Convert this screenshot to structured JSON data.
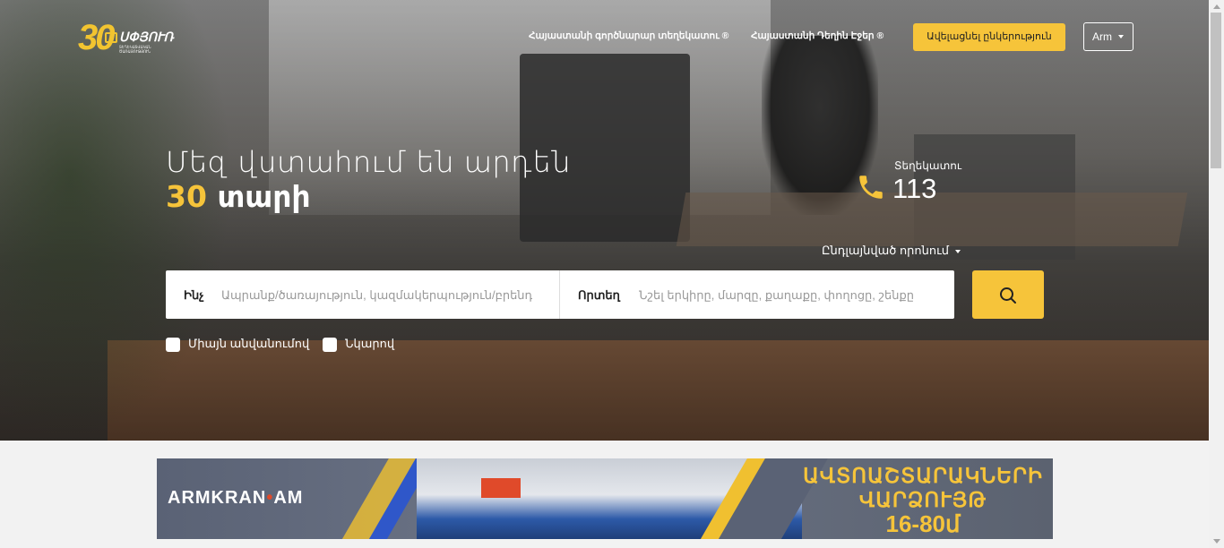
{
  "header": {
    "logo": {
      "number": "30",
      "name": "ՍՓՅՈՒՌ",
      "subtitle": "ՏԵՂԵԿԱՏՎԱԿԱՆ ԾԱՌԱՅՈՒԹՅՈՒՆ"
    },
    "nav": [
      {
        "label": "Հայաստանի գործնարար տեղեկատու ®"
      },
      {
        "label": "Հայաստանի Դեղին Էջեր ®"
      }
    ],
    "add_button": "Ավելացնել ընկերություն",
    "language": "Arm"
  },
  "hero": {
    "headline_line1": "Մեզ վստահում են արդեն",
    "headline_year": "30",
    "headline_word": "տարի",
    "phone_label": "Տեղեկատու",
    "phone_number": "113",
    "advanced_search": "Ընդլայնված որոնում"
  },
  "search": {
    "what_label": "Ինչ",
    "what_placeholder": "Ապրանք/ծառայություն, կազմակերպություն/բրենդ",
    "where_label": "Որտեղ",
    "where_placeholder": "Նշել երկիրը, մարզը, քաղաքը, փողոցը, շենքը",
    "checkbox_name_only": "Միայն անվանումով",
    "checkbox_with_photo": "Նկարով"
  },
  "banner": {
    "brand_left": "ARMKRAN",
    "brand_right": "AM",
    "line1": "ԱՎՏՈԱՇՏԱՐԱԿՆԵՐԻ",
    "line2": "ՎԱՐՁՈՒՅԹ",
    "line3": "16-80մ"
  },
  "colors": {
    "accent": "#f6c43a",
    "white": "#ffffff"
  }
}
